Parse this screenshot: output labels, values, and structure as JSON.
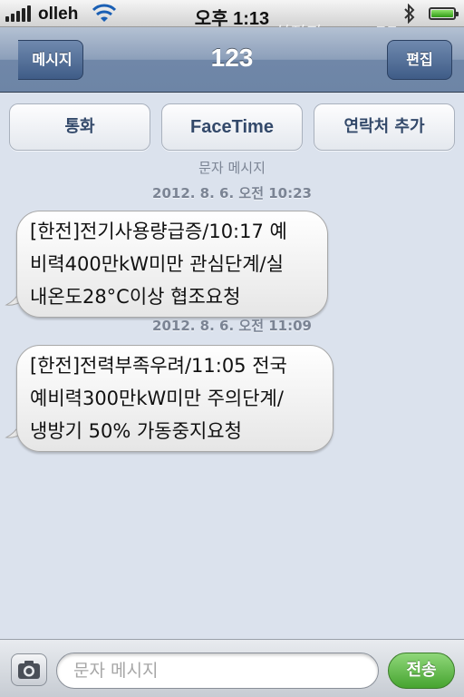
{
  "status_bar": {
    "carrier": "olleh",
    "time": "오후 1:13",
    "icons": [
      "signal-icon",
      "wifi-icon",
      "bluetooth-icon",
      "battery-icon"
    ],
    "watermark": "실전지 www.77g.com"
  },
  "nav": {
    "back_label": "메시지",
    "title": "123",
    "edit_label": "편집"
  },
  "actions": {
    "call_label": "통화",
    "facetime_label": "FaceTime",
    "add_contact_label": "연락처 추가"
  },
  "thread": {
    "section_label": "문자 메시지",
    "messages": [
      {
        "timestamp": "2012. 8. 6. 오전 10:23",
        "lines": [
          "[한전]전기사용량급증/10:17 예",
          "비력400만kW미만 관심단계/실",
          "내온도28°C이상 협조요청"
        ]
      },
      {
        "timestamp": "2012. 8. 6. 오전 11:09",
        "lines": [
          "[한전]전력부족우려/11:05 전국",
          "예비력300만kW미만 주의단계/",
          "냉방기 50% 가동중지요청"
        ]
      }
    ]
  },
  "composer": {
    "placeholder": "문자 메시지",
    "send_label": "전송"
  },
  "colors": {
    "background": "#dbe2ed",
    "nav_bar": "#7087a8",
    "send_green": "#46a42f",
    "action_text": "#33496a"
  }
}
